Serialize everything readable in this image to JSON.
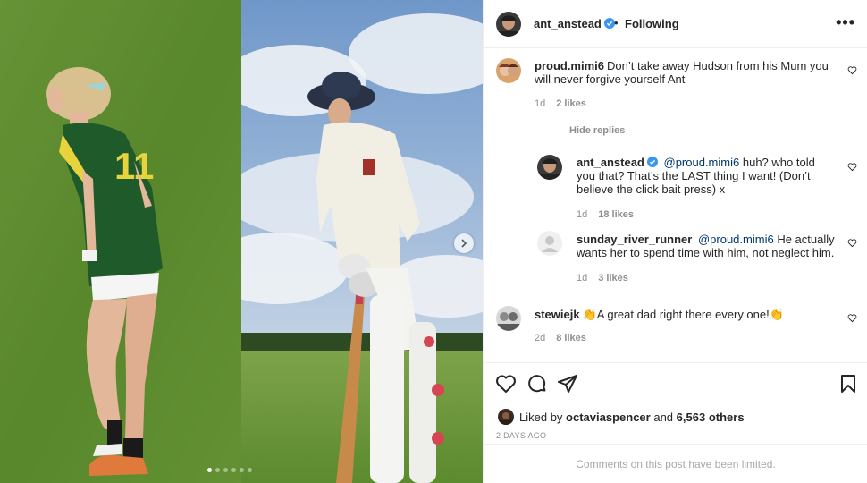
{
  "post": {
    "author": "ant_anstead",
    "separator": "•",
    "follow_status": "Following",
    "more": "•••"
  },
  "media": {
    "carousel_dots": 6,
    "active_dot": 0
  },
  "comments": [
    {
      "username": "proud.mimi6",
      "text": "Don’t take away Hudson from his Mum you will never forgive yourself Ant",
      "time": "1d",
      "likes": "2 likes"
    }
  ],
  "hide_replies_label": "Hide replies",
  "replies": [
    {
      "username": "ant_anstead",
      "mention": "@proud.mimi6",
      "text": "huh? who told you that? That’s the LAST thing I want! (Don’t believe the click bait press) x",
      "time": "1d",
      "likes": "18 likes"
    },
    {
      "username": "sunday_river_runner",
      "mention": "@proud.mimi6",
      "text": "He actually wants her to spend time with him, not neglect him.",
      "time": "1d",
      "likes": "3 likes"
    }
  ],
  "comment2": {
    "username": "stewiejk",
    "emoji_left": "👏",
    "text": "A great dad right there every one!",
    "emoji_right": "👏",
    "time": "2d",
    "likes": "8 likes"
  },
  "footer": {
    "liked_by_prefix": "Liked by",
    "liked_by_user": "octaviaspencer",
    "liked_by_and": "and",
    "liked_by_count": "6,563 others",
    "date": "2 DAYS AGO",
    "comments_limited": "Comments on this post have been limited."
  },
  "colors": {
    "verified": "#3897f0",
    "mention": "#00376b",
    "muted": "#8e8e8e"
  }
}
